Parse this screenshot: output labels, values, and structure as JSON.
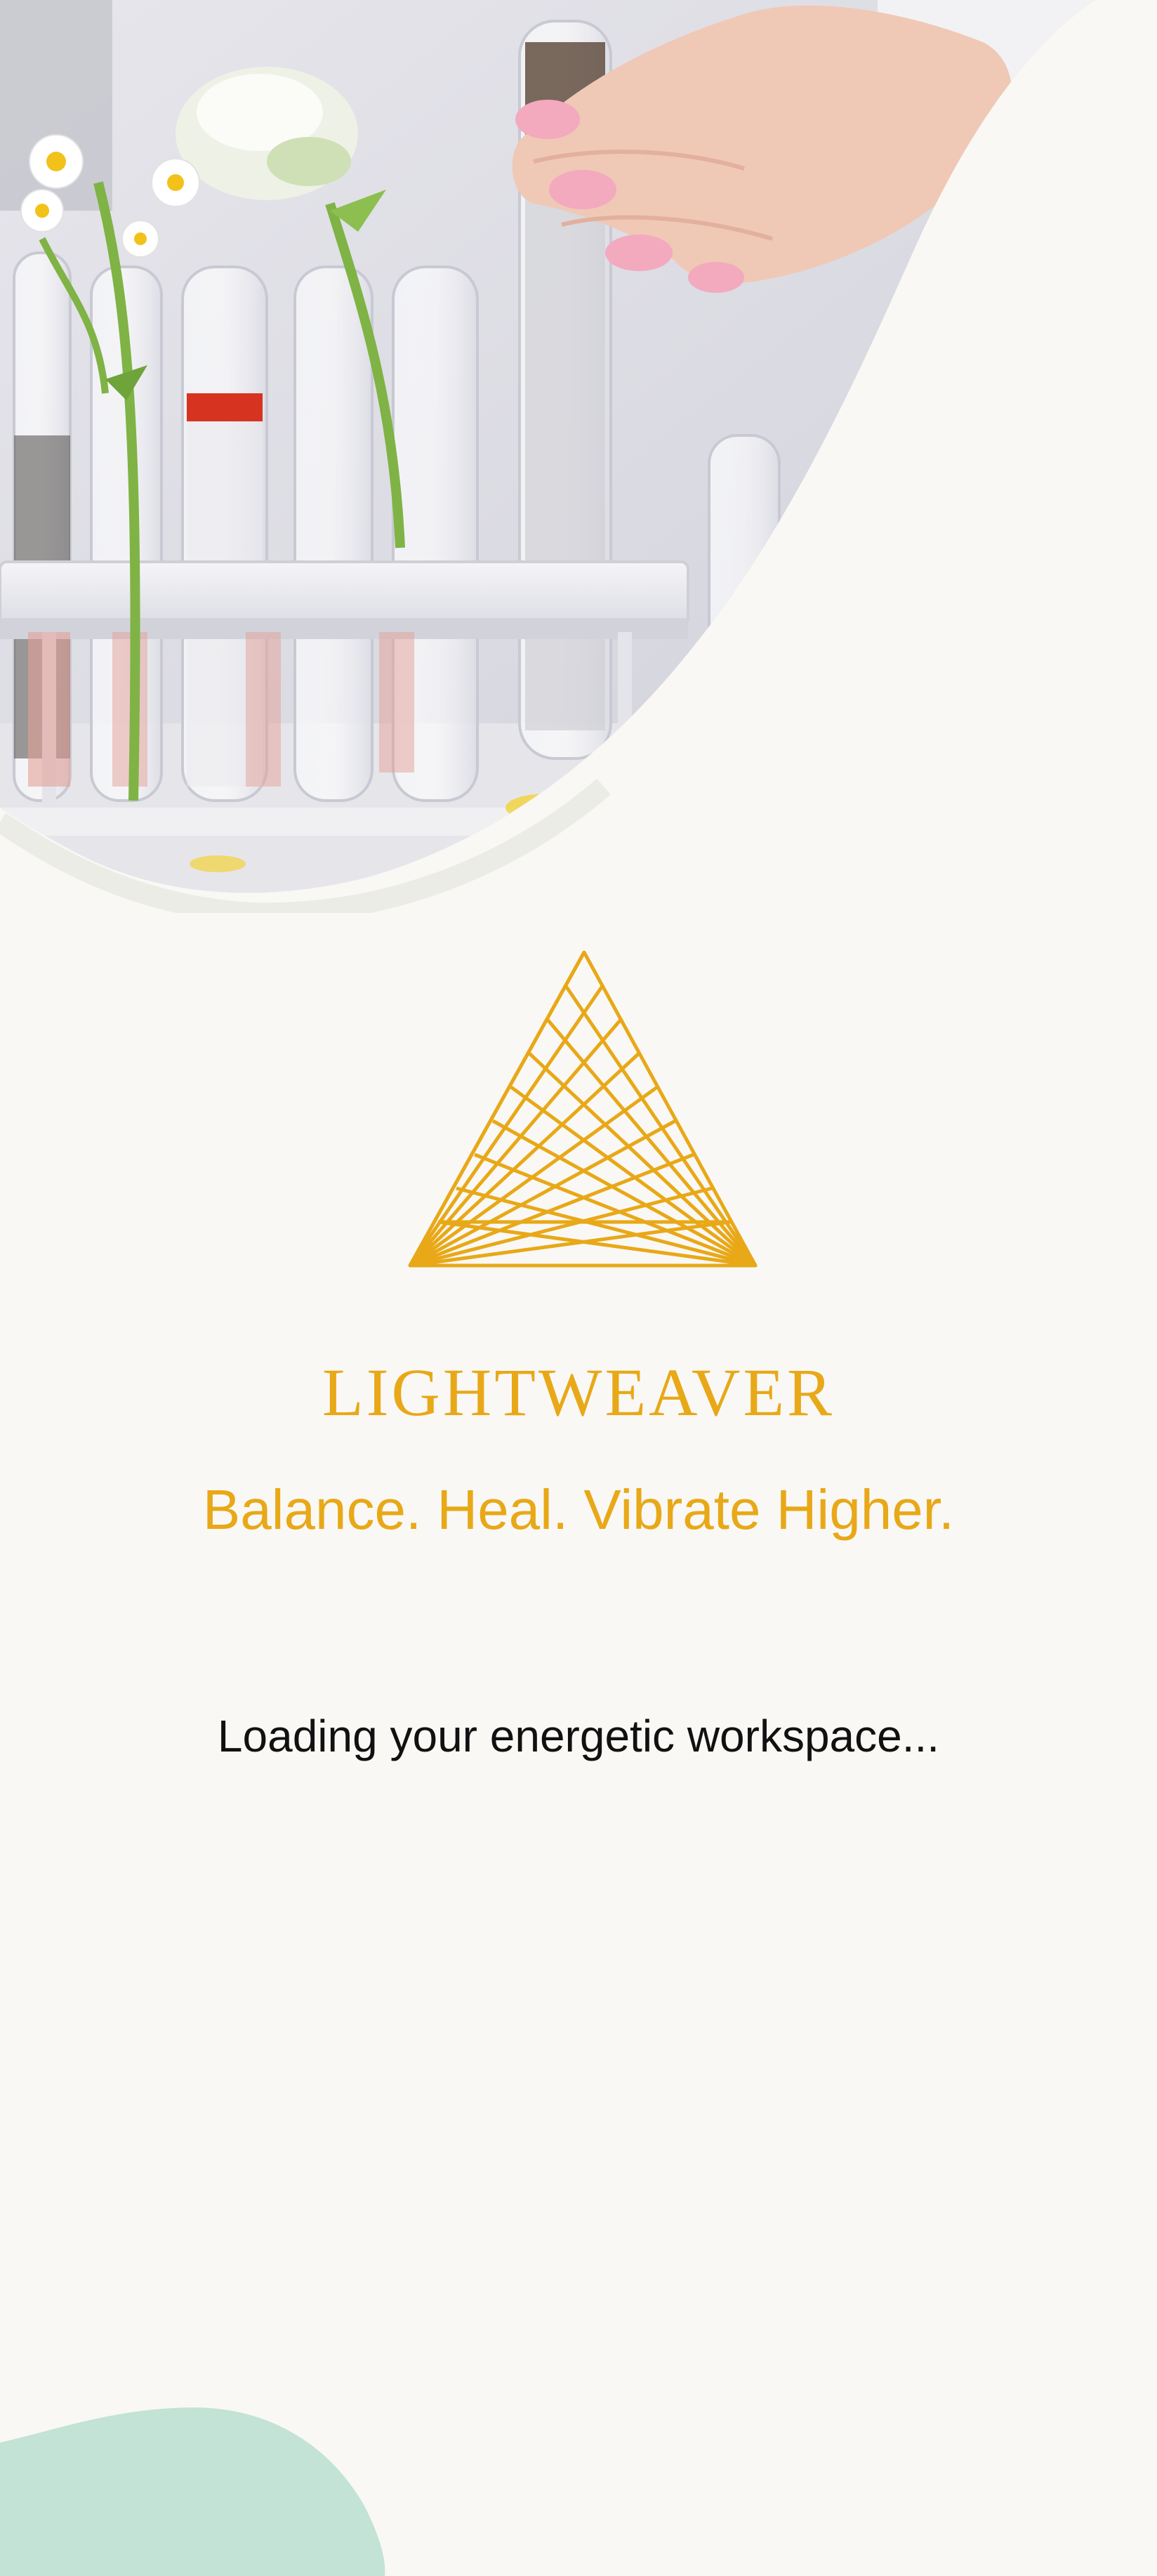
{
  "theme": {
    "background": "#F9F8F5",
    "accent": "#E8A817",
    "text": "#111111",
    "mint_blob": "#C2E3D6"
  },
  "hero": {
    "image_description_icon": "lab-test-tubes-with-flowers-photo"
  },
  "brand": {
    "logo_icon": "geometric-triangle-logo-icon",
    "wordmark": "LIGHTWEAVER",
    "tagline": "Balance. Heal. Vibrate Higher."
  },
  "status": {
    "loading": "Loading your energetic workspace..."
  }
}
